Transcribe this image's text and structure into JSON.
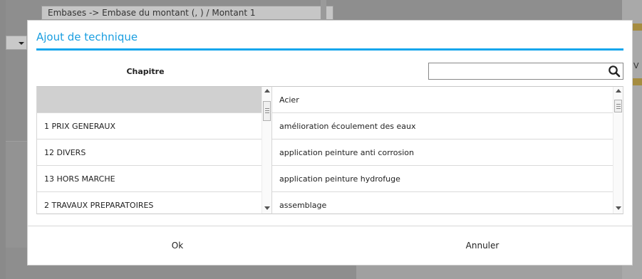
{
  "background": {
    "breadcrumb": "Embases -> Embase du montant (, ) / Montant 1",
    "map_letter": "V"
  },
  "dialog": {
    "title": "Ajout de technique",
    "left_header": "Chapitre",
    "search": {
      "value": "",
      "placeholder": ""
    },
    "chapters": [
      "",
      "1 PRIX GENERAUX",
      "12 DIVERS",
      "13 HORS MARCHE",
      "2 TRAVAUX PREPARATOIRES"
    ],
    "techniques": [
      "Acier",
      "amélioration écoulement des eaux",
      "application peinture anti corrosion",
      "application peinture hydrofuge",
      "assemblage"
    ],
    "ok_label": "Ok",
    "cancel_label": "Annuler"
  },
  "colors": {
    "accent": "#14a6ec",
    "title": "#1a9ee0",
    "selected_row": "#d0d0d0"
  }
}
